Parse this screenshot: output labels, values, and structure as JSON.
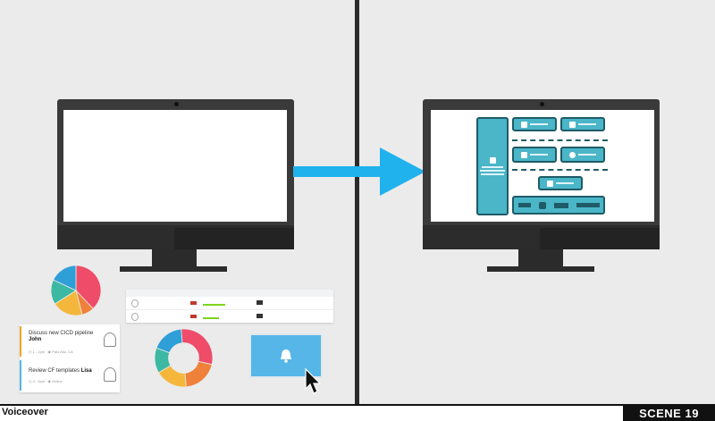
{
  "footer": {
    "voiceover_label": "Voiceover",
    "scene_label": "SCENE 19"
  },
  "tasks": [
    {
      "title": "Discuss new CICD pipeline",
      "assignee": "John",
      "time": "1 - 2pm",
      "location": "Palo Alto, CA",
      "accent": "#f5a623"
    },
    {
      "title": "Review CF templates",
      "assignee": "Lisa",
      "time": "4 - 5pm",
      "location": "Online",
      "accent": "#56b6e8"
    }
  ],
  "donut_chart": {
    "type": "donut",
    "slices": [
      {
        "color": "#ef4c6a",
        "value": 30
      },
      {
        "color": "#f0813a",
        "value": 20
      },
      {
        "color": "#f5b73b",
        "value": 18
      },
      {
        "color": "#3cb8a3",
        "value": 14
      },
      {
        "color": "#2f9fd8",
        "value": 18
      }
    ]
  },
  "pie_chart": {
    "type": "pie",
    "slices": [
      {
        "color": "#ef4c6a",
        "value": 38
      },
      {
        "color": "#f0813a",
        "value": 8
      },
      {
        "color": "#f5b73b",
        "value": 20
      },
      {
        "color": "#3cb8a3",
        "value": 16
      },
      {
        "color": "#2f9fd8",
        "value": 18
      }
    ]
  },
  "colors": {
    "arrow": "#1fb2ec",
    "arch_box": "#4ab6c8",
    "arch_border": "#1f5b66",
    "bell_card": "#56b6e8"
  },
  "icons": {
    "bell": "bell-icon",
    "cursor": "mouse-pointer-icon"
  }
}
